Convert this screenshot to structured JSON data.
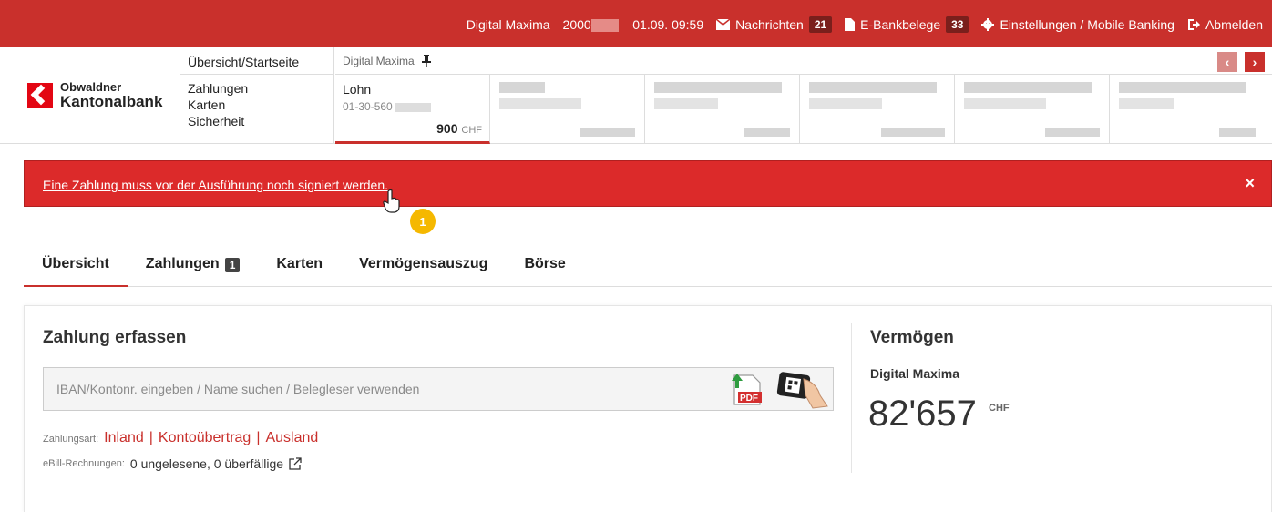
{
  "topbar": {
    "user": "Digital Maxima",
    "contract_prefix": "2000",
    "login_time": "– 01.09. 09:59",
    "messages_label": "Nachrichten",
    "messages_count": "21",
    "ebank_label": "E-Bankbelege",
    "ebank_count": "33",
    "settings_label": "Einstellungen / Mobile Banking",
    "logout_label": "Abmelden"
  },
  "logo": {
    "line1": "Obwaldner",
    "line2": "Kantonalbank"
  },
  "nav": {
    "first": "Übersicht/Startseite",
    "items": [
      "Zahlungen",
      "Karten",
      "Sicherheit"
    ]
  },
  "accounts": {
    "owner": "Digital Maxima",
    "selected": {
      "name": "Lohn",
      "number": "01-30-560",
      "amount": "900",
      "currency": "CHF"
    }
  },
  "alert": {
    "message": "Eine Zahlung muss vor der Ausführung noch signiert werden.",
    "close": "×"
  },
  "marker": "1",
  "tabs": [
    {
      "label": "Übersicht"
    },
    {
      "label": "Zahlungen",
      "badge": "1"
    },
    {
      "label": "Karten"
    },
    {
      "label": "Vermögensauszug"
    },
    {
      "label": "Börse"
    }
  ],
  "payment": {
    "title": "Zahlung erfassen",
    "placeholder": "IBAN/Kontonr. eingeben / Name suchen / Belegleser verwenden",
    "type_label": "Zahlungsart:",
    "types": [
      "Inland",
      "Kontoübertrag",
      "Ausland"
    ],
    "ebill_label": "eBill-Rechnungen:",
    "ebill_text": "0 ungelesene, 0 überfällige"
  },
  "wealth": {
    "title": "Vermögen",
    "account": "Digital Maxima",
    "amount": "82'657",
    "currency": "CHF"
  },
  "colors": {
    "brand_red": "#c9302c",
    "alert_red": "#dc2a2a",
    "marker_yellow": "#f5b800"
  }
}
